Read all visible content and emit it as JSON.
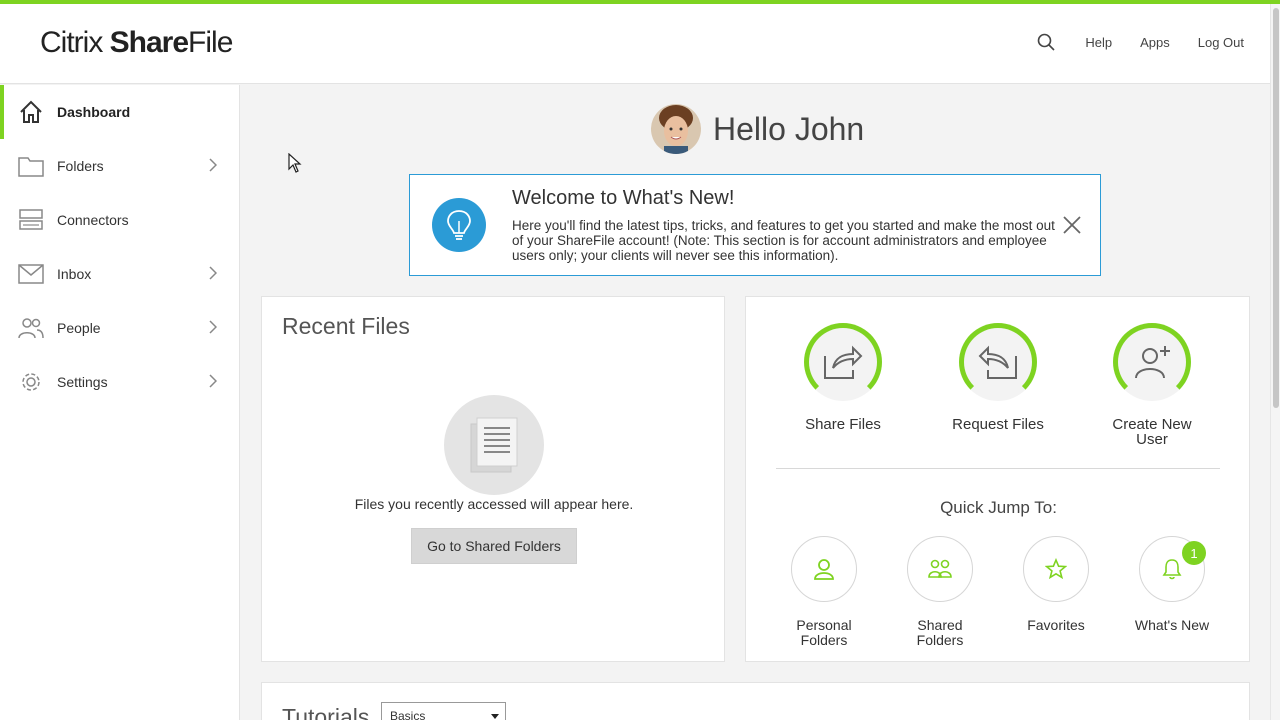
{
  "header": {
    "logo": {
      "part1": "Citrix ",
      "part2": "Share",
      "part3": "File"
    },
    "nav": {
      "help": "Help",
      "apps": "Apps",
      "logout": "Log Out"
    },
    "icons": {
      "search": "search-icon"
    },
    "accent_color": "#7ed321"
  },
  "sidebar": {
    "items": [
      {
        "label": "Dashboard",
        "icon": "home-icon",
        "active": true
      },
      {
        "label": "Folders",
        "icon": "folder-icon",
        "chevron": true
      },
      {
        "label": "Connectors",
        "icon": "connectors-icon",
        "chevron": false
      },
      {
        "label": "Inbox",
        "icon": "mail-icon",
        "chevron": true
      },
      {
        "label": "People",
        "icon": "people-icon",
        "chevron": true
      },
      {
        "label": "Settings",
        "icon": "gear-icon",
        "chevron": true
      }
    ]
  },
  "main": {
    "greeting": "Hello John",
    "whats_new": {
      "title": "Welcome to What's New!",
      "body": "Here you'll find the latest tips, tricks, and features to get you started and make the most out of your ShareFile account! (Note: This section is for account administrators and employee users only; your clients will never see this information).",
      "color": "#2b9bd6"
    },
    "recent_files": {
      "title": "Recent Files",
      "empty_text": "Files you recently accessed will appear here.",
      "button": "Go to Shared Folders"
    },
    "actions": {
      "share": "Share Files",
      "request": "Request Files",
      "create_user": "Create New User"
    },
    "quick_jump": {
      "title": "Quick Jump To:",
      "personal": "Personal Folders",
      "shared": "Shared Folders",
      "favorites": "Favorites",
      "whats_new": "What's New",
      "whats_new_badge": "1"
    },
    "tutorials": {
      "title": "Tutorials",
      "select_value": "Basics"
    }
  }
}
